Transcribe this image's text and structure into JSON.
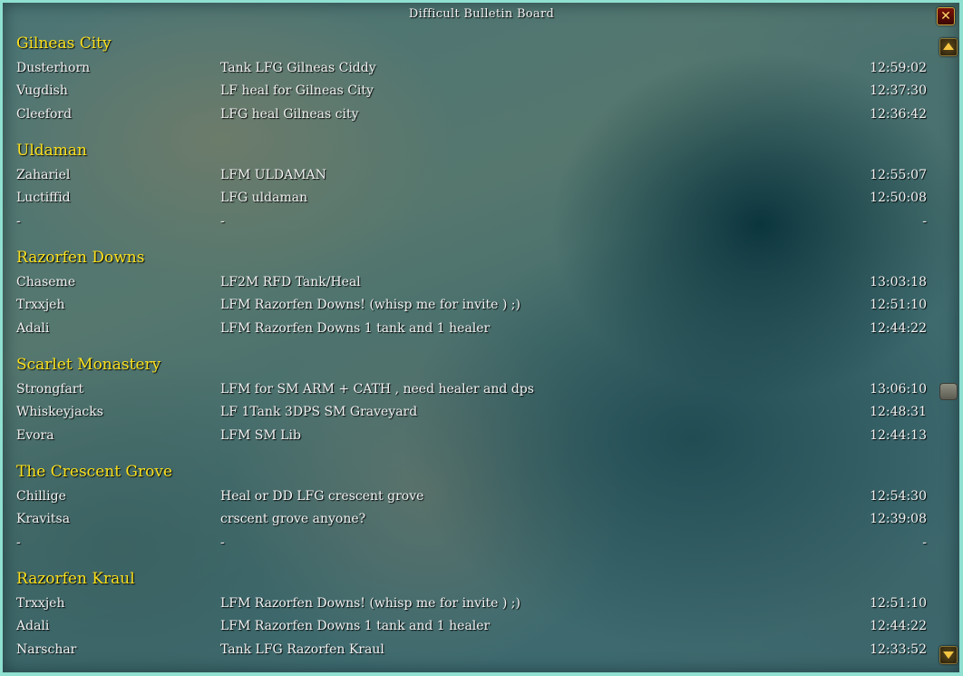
{
  "window": {
    "title": "Difficult Bulletin Board"
  },
  "controls": {
    "close_label": "✕"
  },
  "groups": [
    {
      "name": "Gilneas City",
      "entries": [
        {
          "player": "Dusterhorn",
          "message": "Tank LFG Gilneas Ciddy",
          "time": "12:59:02"
        },
        {
          "player": "Vugdish",
          "message": "LF heal for Gilneas City",
          "time": "12:37:30"
        },
        {
          "player": "Cleeford",
          "message": "LFG heal Gilneas city",
          "time": "12:36:42"
        }
      ]
    },
    {
      "name": "Uldaman",
      "entries": [
        {
          "player": "Zahariel",
          "message": "LFM ULDAMAN",
          "time": "12:55:07"
        },
        {
          "player": "Luctiffid",
          "message": "LFG uldaman",
          "time": "12:50:08"
        },
        {
          "player": "-",
          "message": "-",
          "time": "-"
        }
      ]
    },
    {
      "name": "Razorfen Downs",
      "entries": [
        {
          "player": "Chaseme",
          "message": "LF2M RFD Tank/Heal",
          "time": "13:03:18"
        },
        {
          "player": "Trxxjeh",
          "message": "LFM Razorfen Downs! (whisp me for invite ) ;)",
          "time": "12:51:10"
        },
        {
          "player": "Adali",
          "message": "LFM Razorfen Downs 1 tank and 1 healer",
          "time": "12:44:22"
        }
      ]
    },
    {
      "name": "Scarlet Monastery",
      "entries": [
        {
          "player": "Strongfart",
          "message": "LFM for SM ARM + CATH , need healer and dps",
          "time": "13:06:10"
        },
        {
          "player": "Whiskeyjacks",
          "message": "LF 1Tank 3DPS SM Graveyard",
          "time": "12:48:31"
        },
        {
          "player": "Evora",
          "message": "LFM SM Lib",
          "time": "12:44:13"
        }
      ]
    },
    {
      "name": "The Crescent Grove",
      "entries": [
        {
          "player": "Chillige",
          "message": "Heal or DD LFG crescent grove",
          "time": "12:54:30"
        },
        {
          "player": "Kravitsa",
          "message": "crscent grove anyone?",
          "time": "12:39:08"
        },
        {
          "player": "-",
          "message": "-",
          "time": "-"
        }
      ]
    },
    {
      "name": "Razorfen Kraul",
      "entries": [
        {
          "player": "Trxxjeh",
          "message": "LFM Razorfen Downs! (whisp me for invite ) ;)",
          "time": "12:51:10"
        },
        {
          "player": "Adali",
          "message": "LFM Razorfen Downs 1 tank and 1 healer",
          "time": "12:44:22"
        },
        {
          "player": "Narschar",
          "message": "Tank LFG Razorfen Kraul",
          "time": "12:33:52"
        }
      ]
    }
  ],
  "colors": {
    "group_title": "#fbe11e",
    "row_text": "#f1f1f1"
  },
  "icons": {
    "close": "close-icon",
    "scroll_up": "scroll-up-icon",
    "scroll_down": "scroll-down-icon"
  }
}
